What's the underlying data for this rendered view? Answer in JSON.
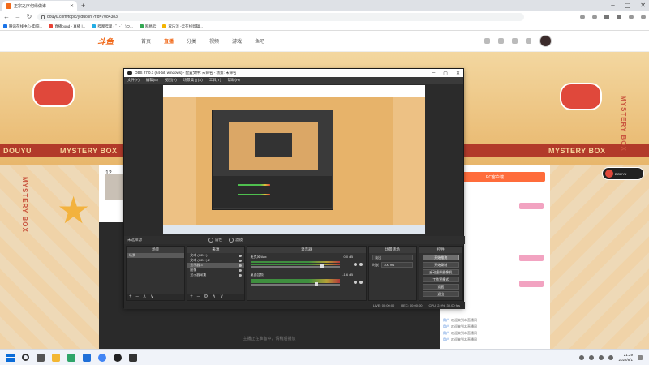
{
  "browser": {
    "tab_title": "正宗之序何缘做谁",
    "url": "douyu.com/topic/yiduoshi?rid=7084383",
    "bookmarks": [
      {
        "label": "腾讯在线中心-电脑...",
        "color": "#1a73e8"
      },
      {
        "label": "直播bond - 真播 |...",
        "color": "#e94235"
      },
      {
        "label": "哔哩哔哩 ( ゜- ゜)つ...",
        "color": "#23ade5"
      },
      {
        "label": "网易云",
        "color": "#34a853"
      },
      {
        "label": "欢乐流 -云在线剪辑...",
        "color": "#f4b400"
      }
    ]
  },
  "site": {
    "logo": "斗鱼",
    "nav": [
      "首页",
      "直播",
      "分类",
      "视频",
      "游戏",
      "鱼吧"
    ],
    "active_nav": "直播",
    "room_num": "12",
    "mystery": "MYSTERY BOX",
    "brand": "DOUYU",
    "video_caption": "主播正在准备中，请稍后播放",
    "panel_head": "PC客户端",
    "chat": [
      {
        "user": "用户",
        "text": "欢迎来到本直播间"
      },
      {
        "user": "用户",
        "text": "欢迎来到本直播间"
      },
      {
        "user": "用户",
        "text": "欢迎来到本直播间"
      },
      {
        "user": "用户",
        "text": "欢迎来到本直播间"
      }
    ]
  },
  "obs": {
    "title": "OBS 27.0.1 (64-bit, windows) - 配置文件: 未命名 - 场景: 未命名",
    "menu": [
      "文件(F)",
      "编辑(E)",
      "视图(V)",
      "场景集合(S)",
      "工具(T)",
      "帮助(H)"
    ],
    "status_label": "未选择源",
    "props_label": "属性",
    "filters_label": "滤镜",
    "docks": {
      "scenes": {
        "title": "场景",
        "items": [
          "场景"
        ]
      },
      "sources": {
        "title": "来源",
        "items": [
          "文本 (GDI+)",
          "文本 (GDI+) 2",
          "显示器 3",
          "图像",
          "显示器采集"
        ]
      },
      "mixer": {
        "title": "混音器",
        "channels": [
          {
            "name": "麦克风/Aux",
            "db": "0.0 dB",
            "level": 0.82
          },
          {
            "name": "桌面音频",
            "db": "-1.6 dB",
            "level": 0.75
          }
        ]
      },
      "transitions": {
        "title": "场景转场",
        "type": "淡出",
        "duration_label": "时长",
        "duration": "300 ms"
      },
      "controls": {
        "title": "控件",
        "buttons": [
          "开始推流",
          "开始录制",
          "启动虚拟摄像机",
          "工作室模式",
          "设置",
          "退出"
        ]
      }
    },
    "footer": {
      "live": "LIVE: 00:00:00",
      "rec": "REC: 00:00:00",
      "cpu": "CPU: 2.9%, 30.00 fps"
    }
  },
  "taskbar": {
    "time": "21:29",
    "date": "2022/8/1"
  },
  "colors": {
    "accent": "#f16a1b",
    "obs_bg": "#2b2b2b"
  }
}
